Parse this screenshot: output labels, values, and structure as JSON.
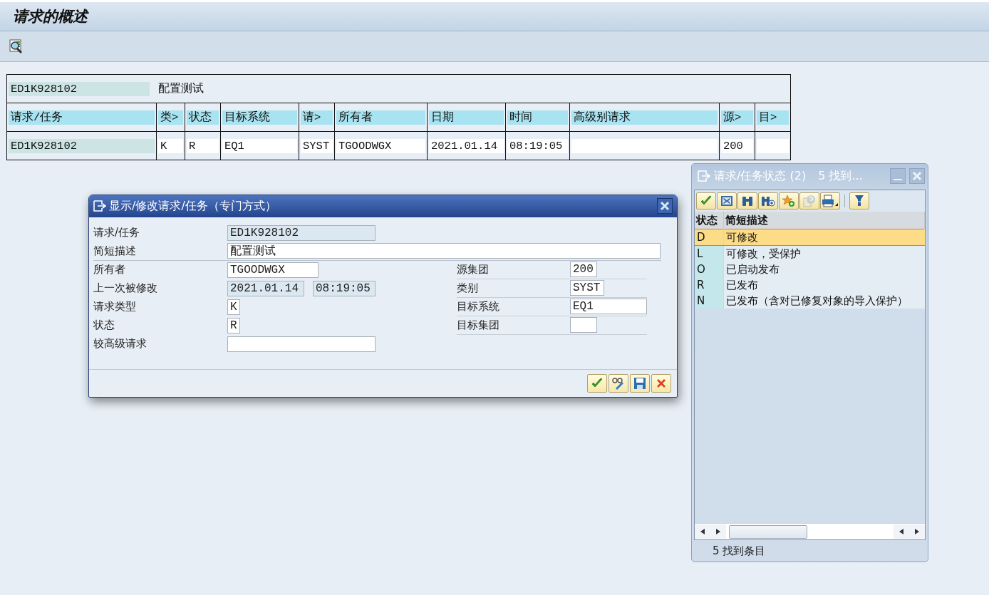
{
  "window": {
    "title": "请求的概述"
  },
  "request_list": {
    "request": "ED1K928102",
    "description": "配置测试",
    "columns": [
      "请求/任务",
      "类>",
      "状态",
      "目标系统",
      "请>",
      "所有者",
      "日期",
      "时间",
      "高级别请求",
      "源>",
      "目>"
    ],
    "rows": [
      {
        "request": "ED1K928102",
        "type": "K",
        "status": "R",
        "target_system": "EQ1",
        "category": "SYST",
        "owner": "TGOODWGX",
        "date": "2021.01.14",
        "time": "08:19:05",
        "source_client": "200"
      }
    ]
  },
  "dialog": {
    "title": "显示/修改请求/任务（专门方式）",
    "fields_top": [
      {
        "label": "请求/任务",
        "inputs": [
          {
            "value": "ED1K928102",
            "disabled": true
          }
        ]
      },
      {
        "label": "简短描述",
        "inputs": [
          {
            "value": "配置测试",
            "disabled": false
          }
        ]
      }
    ],
    "fields_left": [
      {
        "label": "所有者",
        "inputs": [
          {
            "value": "TGOODWGX",
            "disabled": false
          }
        ]
      },
      {
        "label": "上一次被修改",
        "inputs": [
          {
            "value": "2021.01.14",
            "disabled": true
          },
          {
            "value": "08:19:05",
            "disabled": true
          }
        ]
      },
      {
        "label": "请求类型",
        "inputs": [
          {
            "value": "K",
            "disabled": false
          }
        ]
      },
      {
        "label": "状态",
        "inputs": [
          {
            "value": "R",
            "disabled": false
          }
        ]
      },
      {
        "label": "较高级请求",
        "inputs": [
          {
            "disabled": false
          }
        ]
      }
    ],
    "fields_right": [
      {
        "label": "源集团",
        "inputs": [
          {
            "value": "200",
            "disabled": false
          }
        ]
      },
      {
        "label": "类别",
        "inputs": [
          {
            "value": "SYST",
            "disabled": false
          }
        ]
      },
      {
        "label": "目标系统",
        "inputs": [
          {
            "value": "EQ1",
            "disabled": false
          }
        ]
      },
      {
        "label": "目标集团",
        "inputs": [
          {
            "disabled": false
          }
        ]
      }
    ]
  },
  "popup": {
    "title": "请求/任务状态 (2)",
    "hits": "5 找到...",
    "columns": [
      "状态",
      "简短描述"
    ],
    "rows": [
      {
        "key": "D",
        "text": "可修改",
        "selected": true
      },
      {
        "key": "L",
        "text": "可修改，受保护",
        "selected": false
      },
      {
        "key": "O",
        "text": "已启动发布",
        "selected": false
      },
      {
        "key": "R",
        "text": "已发布",
        "selected": false
      },
      {
        "key": "N",
        "text": "已发布（含对已修复对象的导入保护）",
        "selected": false
      }
    ],
    "status": "5 找到条目"
  }
}
